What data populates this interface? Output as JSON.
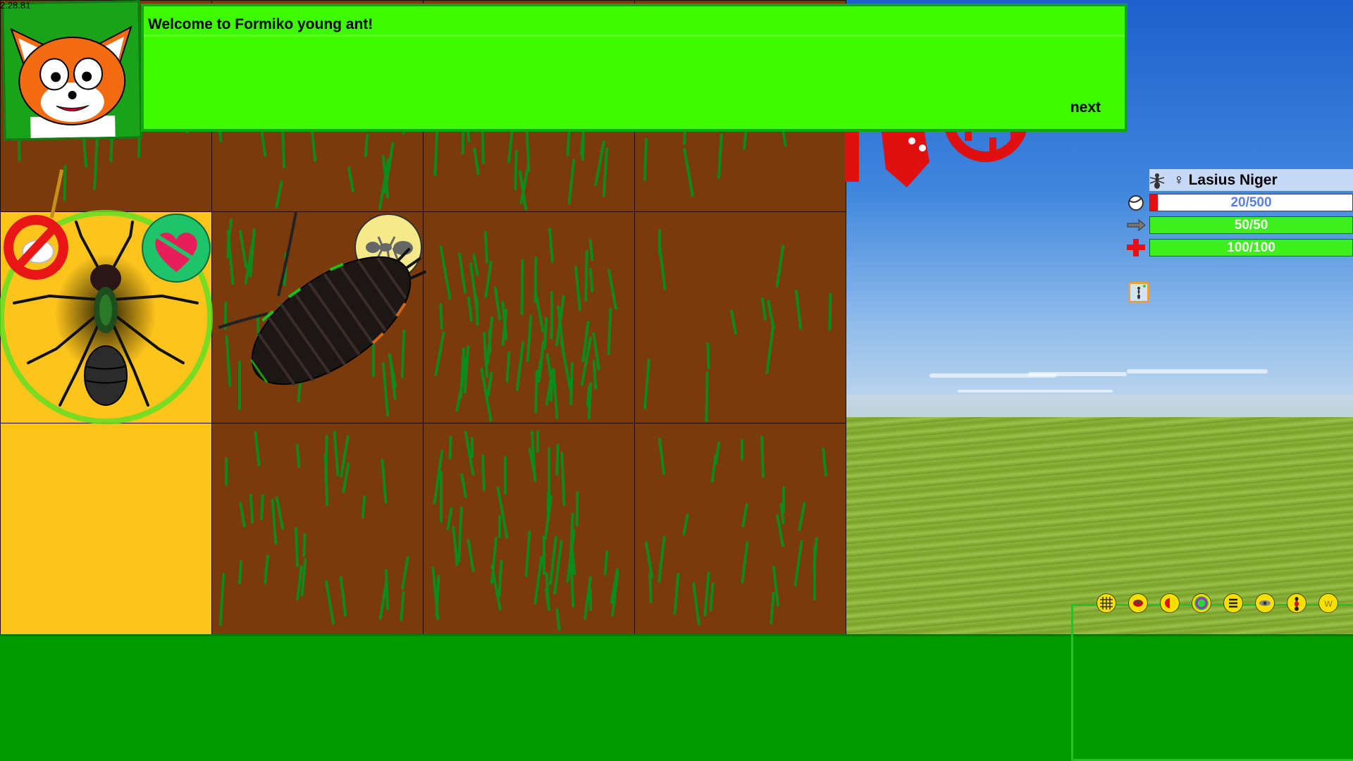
{
  "version": "2.28.81",
  "dialog": {
    "message": "Welcome to Formiko young ant!",
    "next_label": "next"
  },
  "creature": {
    "name": "Lasius Niger",
    "sex_symbol": "♀",
    "food_text": "20/500",
    "food_fraction": 0.04,
    "speed_text": "50/50",
    "health_text": "100/100"
  },
  "colors": {
    "dialog_bg": "#3ffb00",
    "soil": "#7a3a0c",
    "selected_tile": "#fdc41b",
    "bottom_panel": "#009a00"
  },
  "toolbar": [
    {
      "icon": "grid-icon"
    },
    {
      "icon": "red-ant-icon"
    },
    {
      "icon": "half-circle-icon"
    },
    {
      "icon": "purple-ring-icon"
    },
    {
      "icon": "menu-lines-icon"
    },
    {
      "icon": "eye-icon"
    },
    {
      "icon": "queen-ant-icon"
    },
    {
      "icon": "w-letter-icon"
    }
  ]
}
